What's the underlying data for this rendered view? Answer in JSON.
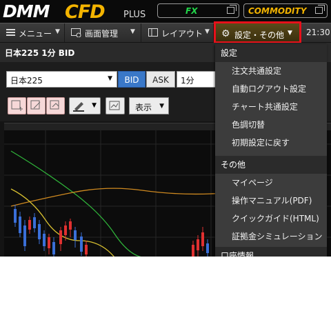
{
  "header": {
    "logo_main": "DMM",
    "logo_cfd": "CFD",
    "logo_plus": "PLUS",
    "fx_label": "FX",
    "commodity_label": "COMMODITY"
  },
  "menubar": {
    "menu_label": "メニュー",
    "chart_label": "画面管理",
    "layout_label": "レイアウト",
    "settings_label": "設定・その他",
    "clock": "21:30"
  },
  "chart_window": {
    "title": "日本225 1分 BID",
    "symbol": "日本225",
    "bid_label": "BID",
    "ask_label": "ASK",
    "timeframe": "1分",
    "display_label": "表示"
  },
  "dropdown": {
    "section_settings": "設定",
    "settings_items": [
      "注文共通設定",
      "自動ログアウト設定",
      "チャート共通設定",
      "色調切替",
      "初期設定に戻す"
    ],
    "section_other": "その他",
    "other_items": [
      "マイページ",
      "操作マニュアル(PDF)",
      "クイックガイド(HTML)",
      "証拠金シミュレーション"
    ],
    "partial_item": "口座情報"
  },
  "colors": {
    "fx_green": "#22d64a",
    "commodity_yellow": "#f2b300",
    "bid_blue": "#3a78c8",
    "highlight_red": "#e8101a"
  }
}
